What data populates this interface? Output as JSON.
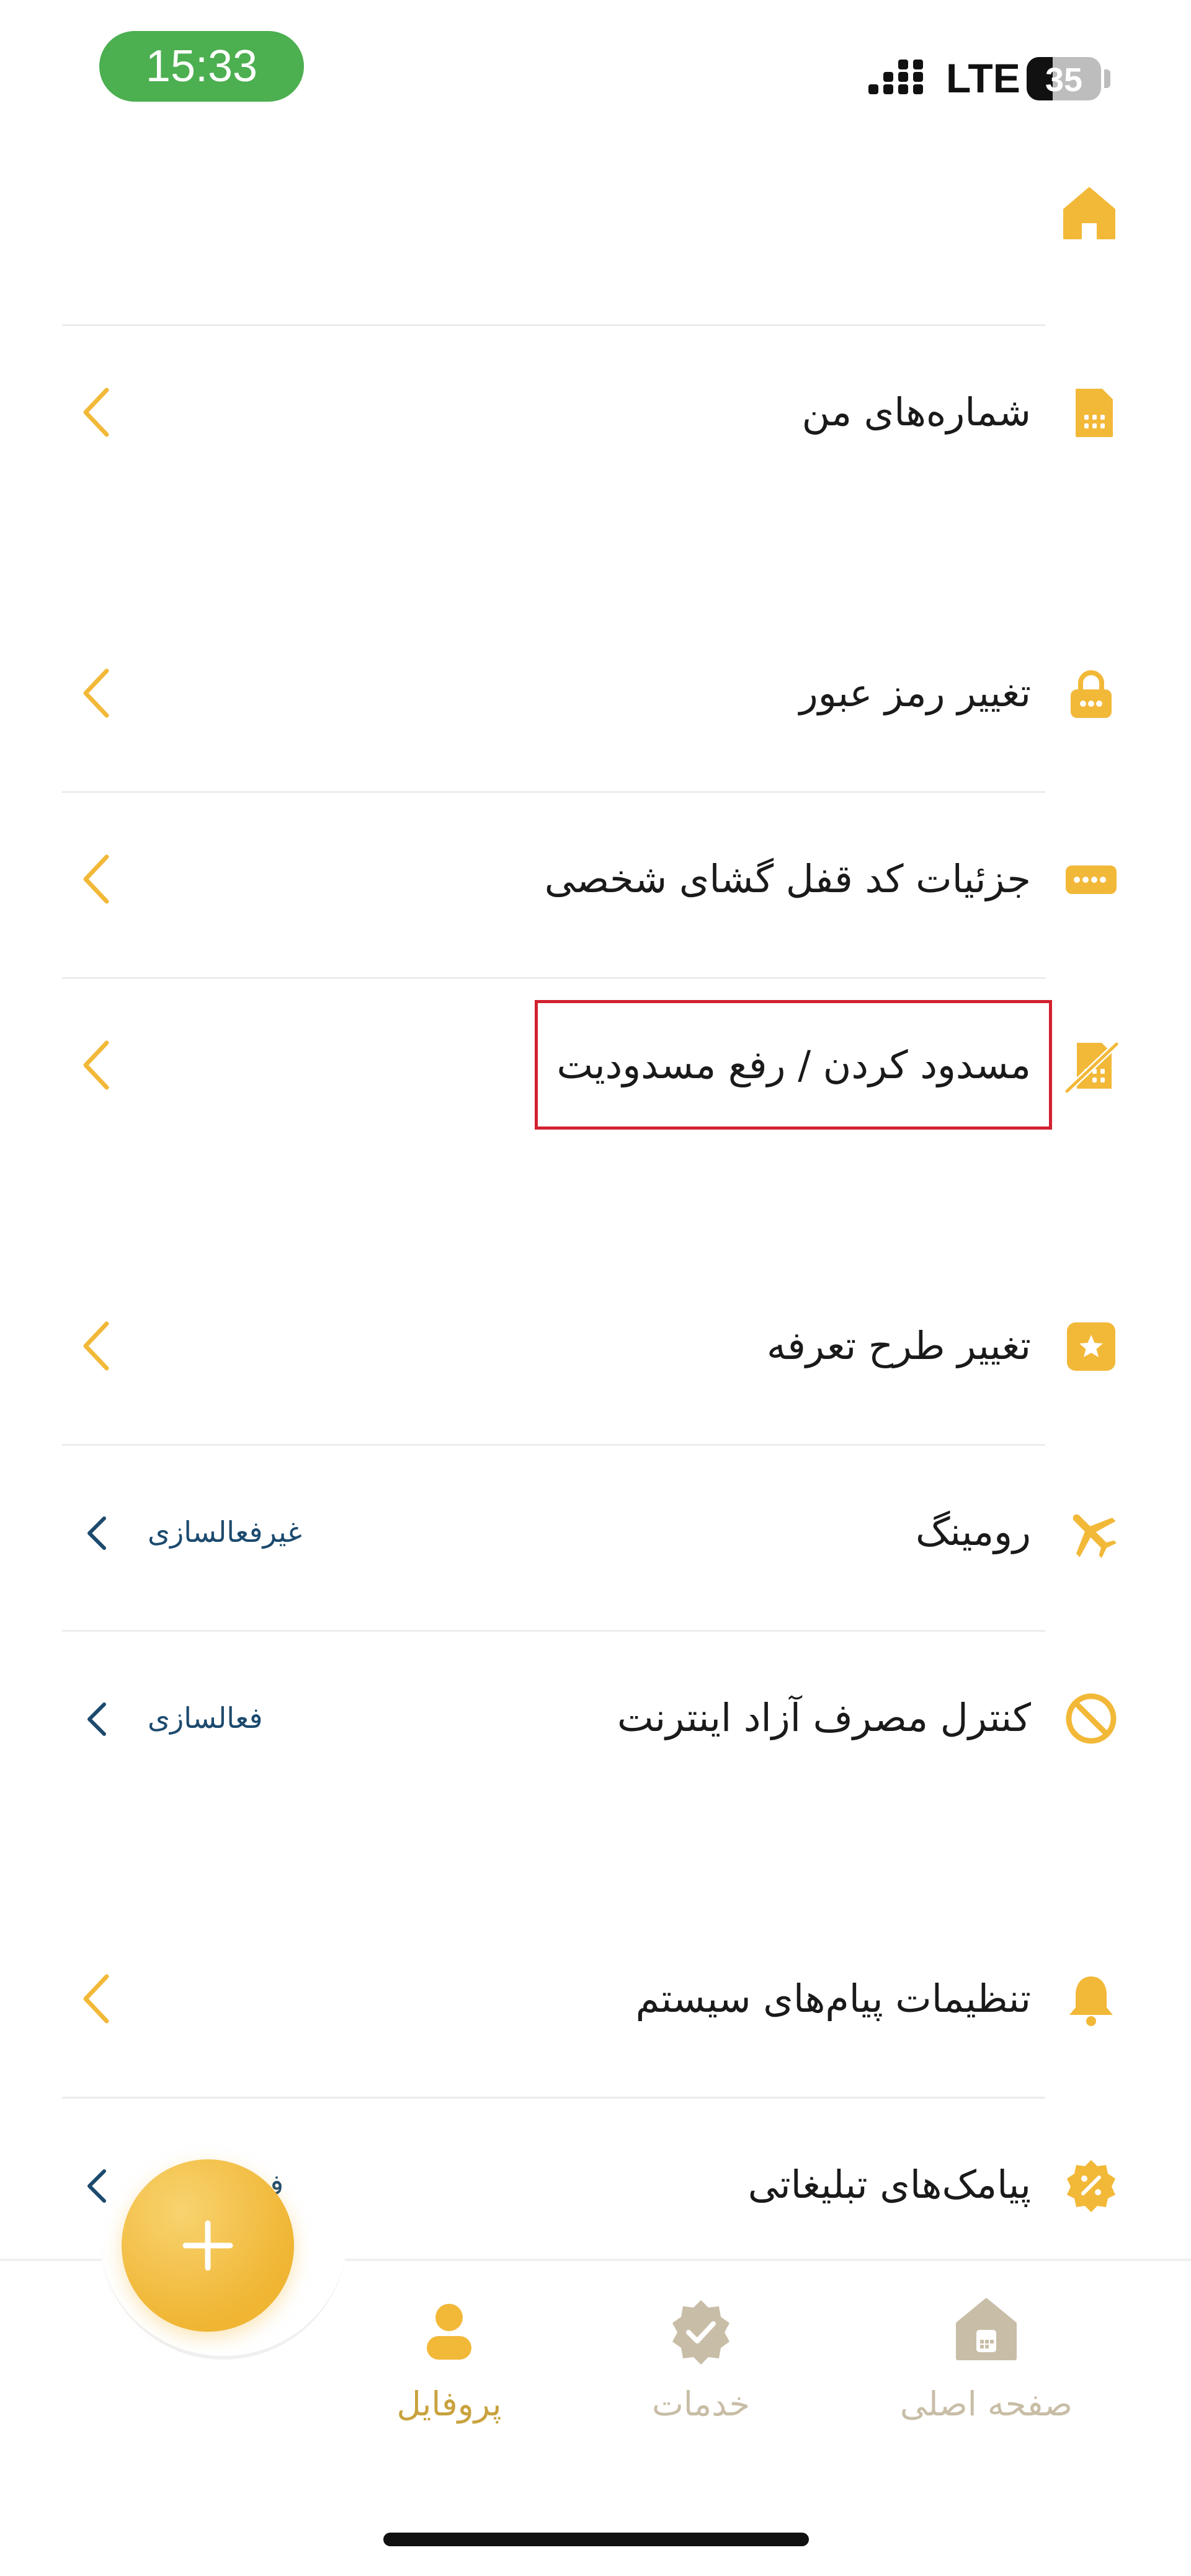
{
  "status_bar": {
    "time": "15:33",
    "network": "LTE",
    "battery": "35",
    "battery_level_percent": 35
  },
  "colors": {
    "accent": "#F2B838",
    "time_pill": "#4CAF50",
    "link": "#1C4A6E",
    "highlight_border": "#D32030",
    "inactive_nav": "#C8BDA6"
  },
  "menu": {
    "home_icon": "home-icon",
    "my_numbers": {
      "label": "شماره‌های من",
      "icon": "sim-card-icon"
    },
    "change_password": {
      "label": "تغییر رمز عبور",
      "icon": "lock-icon"
    },
    "puk_details": {
      "label": "جزئیات کد قفل گشای شخصی",
      "icon": "pin-dots-icon"
    },
    "block_unblock": {
      "label": "مسدود کردن / رفع مسدودیت",
      "icon": "blocked-sim-icon"
    },
    "change_tariff": {
      "label": "تغییر طرح تعرفه",
      "icon": "star-tag-icon"
    },
    "roaming": {
      "label": "رومینگ",
      "link": "غیرفعالسازی",
      "icon": "airplane-icon"
    },
    "internet_control": {
      "label": "کنترل مصرف آزاد اینترنت",
      "link": "فعالسازی",
      "icon": "block-circle-icon"
    },
    "system_messages": {
      "label": "تنظیمات پیام‌های سیستم",
      "icon": "bell-icon"
    },
    "promo_sms": {
      "label": "پیامک‌های تبلیغاتی",
      "link": "ف",
      "icon": "percent-badge-icon"
    }
  },
  "bottom_nav": {
    "fab_icon": "plus-icon",
    "profile": {
      "label": "پروفایل",
      "icon": "person-icon"
    },
    "services": {
      "label": "خدمات",
      "icon": "check-badge-icon"
    },
    "home": {
      "label": "صفحه اصلی",
      "icon": "home-sim-icon"
    }
  }
}
